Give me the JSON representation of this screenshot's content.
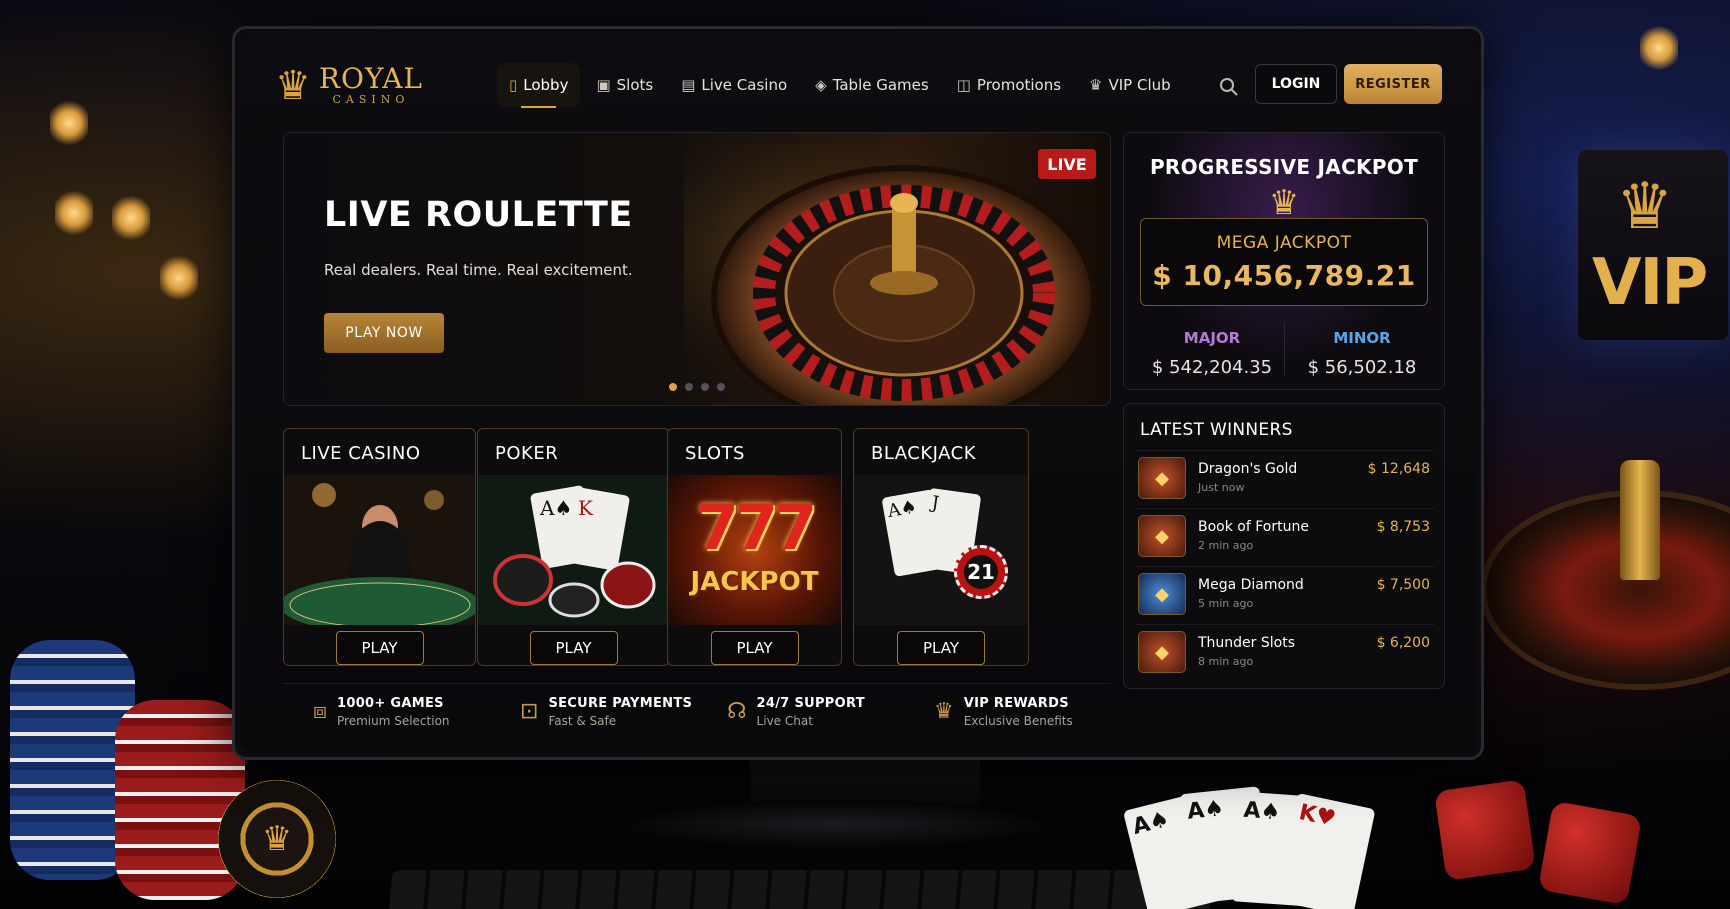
{
  "brand": {
    "name": "ROYAL",
    "sub": "CASINO",
    "crown_icon": "crown-icon"
  },
  "nav": {
    "items": [
      {
        "label": "Lobby",
        "icon": "lobby-icon"
      },
      {
        "label": "Slots",
        "icon": "slots-icon"
      },
      {
        "label": "Live Casino",
        "icon": "live-casino-icon"
      },
      {
        "label": "Table Games",
        "icon": "table-games-icon"
      },
      {
        "label": "Promotions",
        "icon": "gift-icon"
      },
      {
        "label": "VIP Club",
        "icon": "crown-icon"
      }
    ],
    "active": "Lobby",
    "login": "LOGIN",
    "register": "REGISTER"
  },
  "hero": {
    "badge": "LIVE",
    "title": "LIVE ROULETTE",
    "subtitle": "Real dealers. Real time. Real excitement.",
    "cta": "PLAY NOW",
    "slides": 4,
    "active_slide": 1
  },
  "games": [
    {
      "title": "LIVE CASINO",
      "play": "PLAY"
    },
    {
      "title": "POKER",
      "play": "PLAY"
    },
    {
      "title": "SLOTS",
      "play": "PLAY",
      "art_text_1": "777",
      "art_text_2": "JACKPOT"
    },
    {
      "title": "BLACKJACK",
      "play": "PLAY",
      "chip_text": "21"
    }
  ],
  "features": [
    {
      "label": "1000+ GAMES",
      "sub": "Premium Selection",
      "icon": "game-box-icon"
    },
    {
      "label": "SECURE PAYMENTS",
      "sub": "Fast & Safe",
      "icon": "lock-icon"
    },
    {
      "label": "24/7 SUPPORT",
      "sub": "Live Chat",
      "icon": "headset-icon"
    },
    {
      "label": "VIP REWARDS",
      "sub": "Exclusive Benefits",
      "icon": "crown-icon"
    }
  ],
  "jackpot": {
    "title": "PROGRESSIVE JACKPOT",
    "mega_label": "MEGA JACKPOT",
    "mega_value": "$ 10,456,789.21",
    "major_label": "MAJOR",
    "major_value": "$ 542,204.35",
    "minor_label": "MINOR",
    "minor_value": "$ 56,502.18",
    "colors": {
      "major": "#b67ad8",
      "minor": "#5aa6e6",
      "gold": "#e5b453"
    }
  },
  "winners": {
    "title": "LATEST WINNERS",
    "items": [
      {
        "game": "Dragon's Gold",
        "time": "Just now",
        "amount": "$ 12,648"
      },
      {
        "game": "Book of Fortune",
        "time": "2 min ago",
        "amount": "$ 8,753"
      },
      {
        "game": "Mega Diamond",
        "time": "5 min ago",
        "amount": "$ 7,500"
      },
      {
        "game": "Thunder Slots",
        "time": "8 min ago",
        "amount": "$ 6,200"
      }
    ]
  },
  "background": {
    "vip_sign": "VIP"
  }
}
